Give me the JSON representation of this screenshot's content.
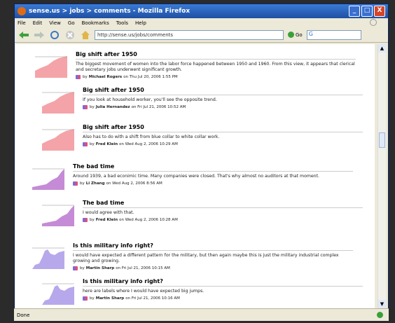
{
  "window": {
    "title": "sense.us > jobs > comments - Mozilla Firefox",
    "buttons": [
      "_",
      "□",
      "X"
    ]
  },
  "menu": [
    "File",
    "Edit",
    "View",
    "Go",
    "Bookmarks",
    "Tools",
    "Help"
  ],
  "toolbar": {
    "url": "http://sense.us/jobs/comments",
    "go_label": "Go",
    "search_label": "G"
  },
  "status": {
    "text": "Done"
  },
  "comments": [
    {
      "title": "Big shift after 1950",
      "body": "The biggest movement of women into the labor force happened between 1950 and 1960. From this view, it appears that clerical and secretary jobs underwent significant growth.",
      "by": "by",
      "author": "Michael Rogers",
      "date": "on Thu Jul 20, 2006 1:55 PM",
      "chart": "pink"
    },
    {
      "title": "Big shift after 1950",
      "body": "If you look at household worker, you'll see the opposite trend.",
      "by": "by",
      "author": "Julia Hernandez",
      "date": "on Fri Jul 21, 2006 10:52 AM",
      "chart": "pink"
    },
    {
      "title": "Big shift after 1950",
      "body": "Also has to do with a shift from blue collar to white collar work.",
      "by": "by",
      "author": "Fred Klein",
      "date": "on Wed Aug 2, 2006 10:29 AM",
      "chart": "pink"
    },
    {
      "title": "The bad time",
      "body": "Around 1939, a bad econimic time. Many companies were closed. That's why almost no auditors at that moment.",
      "by": "by",
      "author": "Li Zhang",
      "date": "on Wed Aug 2, 2006 8:56 AM",
      "chart": "mixed"
    },
    {
      "title": "The bad time",
      "body": "I would agree with that.",
      "by": "by",
      "author": "Fred Klein",
      "date": "on Wed Aug 2, 2006 10:28 AM",
      "chart": "mixed"
    },
    {
      "title": "Is this military info right?",
      "body": "I would have expected a different pattern for the military, but then again maybe this is just the military industrial complex growing and growing.",
      "by": "by",
      "author": "Martin Sharp",
      "date": "on Fri Jul 21, 2006 10:15 AM",
      "chart": "blue"
    },
    {
      "title": "Is this military info right?",
      "body": "here are labels where I would have expected big jumps.",
      "by": "by",
      "author": "Martin Sharp",
      "date": "on Fri Jul 21, 2006 10:16 AM",
      "chart": "blue"
    }
  ]
}
